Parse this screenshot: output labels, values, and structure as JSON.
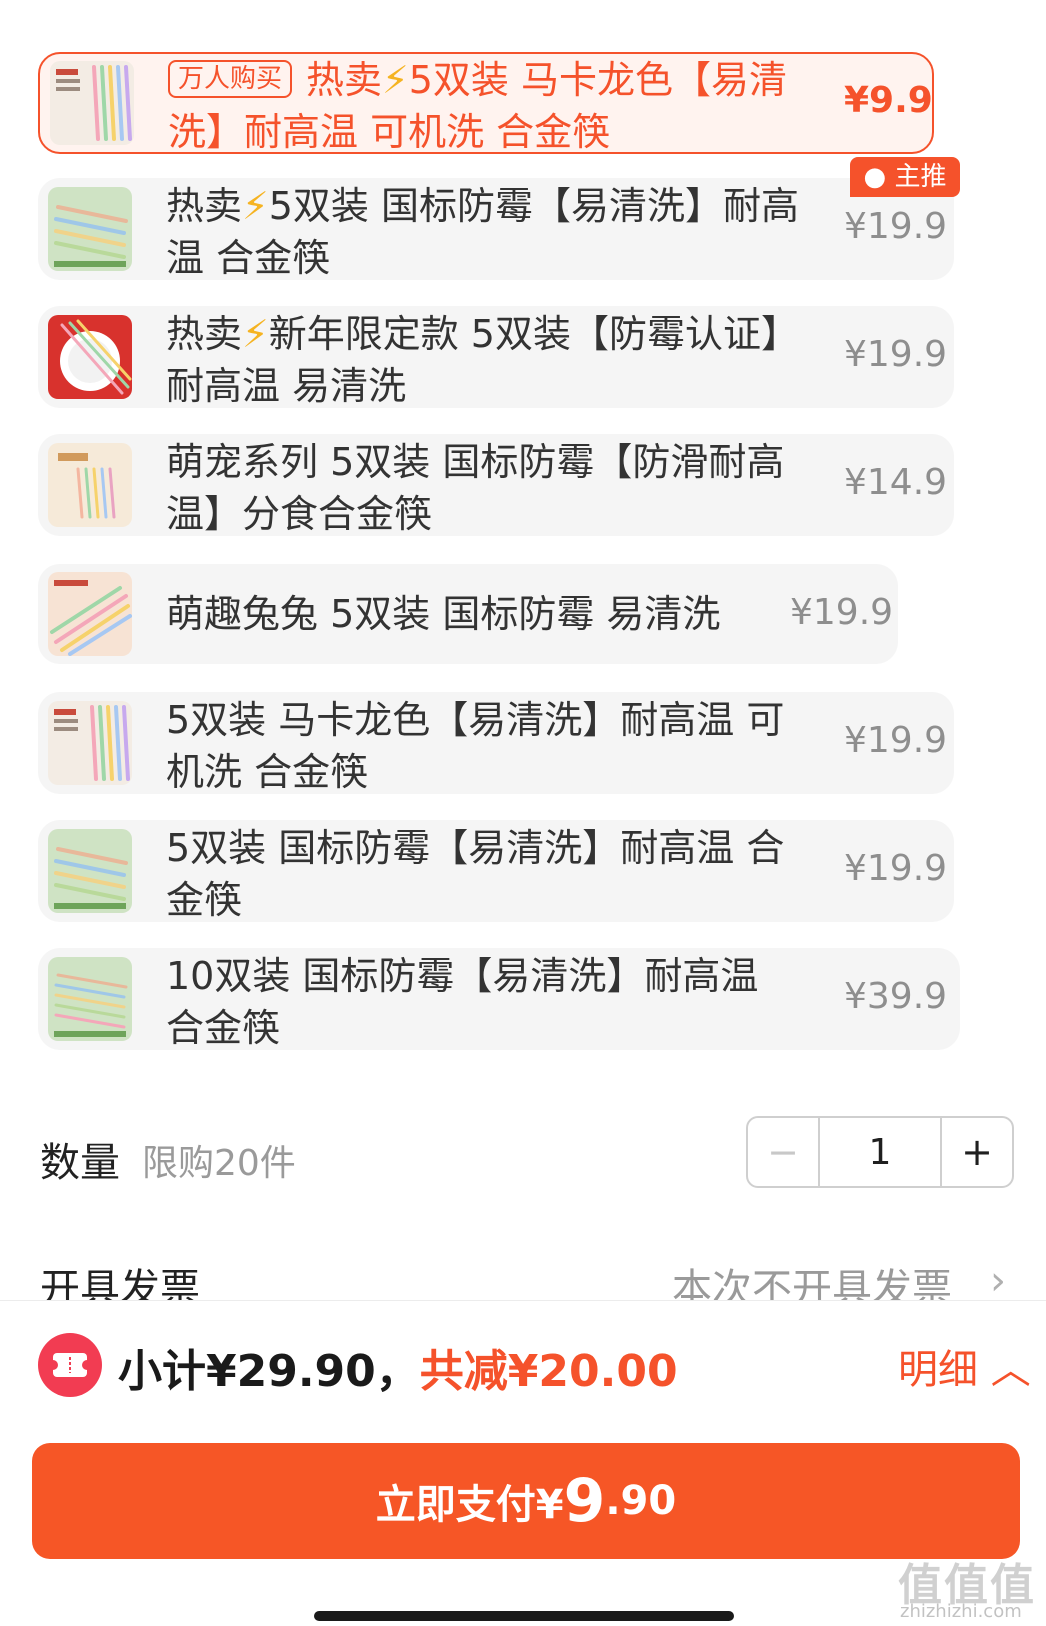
{
  "options": [
    {
      "tag": "万人购买",
      "title": "热卖⚡5双装 马卡龙色【易清洗】耐高温 可机洗 合金筷",
      "price": "¥9.9",
      "selected": true
    },
    {
      "title": "热卖⚡5双装 国标防霉【易清洗】耐高温 合金筷",
      "price": "¥19.9",
      "badge": "主推"
    },
    {
      "title": "热卖⚡新年限定款 5双装【防霉认证】耐高温 易清洗",
      "price": "¥19.9"
    },
    {
      "title": "萌宠系列 5双装 国标防霉【防滑耐高温】分食合金筷",
      "price": "¥14.9"
    },
    {
      "title": "萌趣兔兔 5双装 国标防霉 易清洗",
      "price": "¥19.9"
    },
    {
      "title": "5双装 马卡龙色【易清洗】耐高温 可机洗 合金筷",
      "price": "¥19.9"
    },
    {
      "title": "5双装 国标防霉【易清洗】耐高温 合金筷",
      "price": "¥19.9"
    },
    {
      "title": "10双装 国标防霉【易清洗】耐高温 合金筷",
      "price": "¥39.9"
    }
  ],
  "quantity": {
    "label": "数量",
    "limit": "限购20件",
    "value": "1",
    "minus": "−",
    "plus": "+"
  },
  "invoice": {
    "label": "开具发票",
    "value": "本次不开具发票",
    "chevron": "›"
  },
  "summary": {
    "subtotal": "小计¥29.90，",
    "discount": "共减¥20.00",
    "detail": "明细"
  },
  "pay_button": {
    "label": "立即支付¥",
    "amount_int": "9",
    "amount_dec": ".90"
  },
  "watermark": {
    "text": "值值值",
    "sub": "zhizhizhi.com"
  },
  "colors": {
    "accent": "#f5522b",
    "pay": "#f65626",
    "coupon": "#f23c52",
    "muted": "#9a9a9a",
    "row_bg": "#f5f5f5"
  }
}
